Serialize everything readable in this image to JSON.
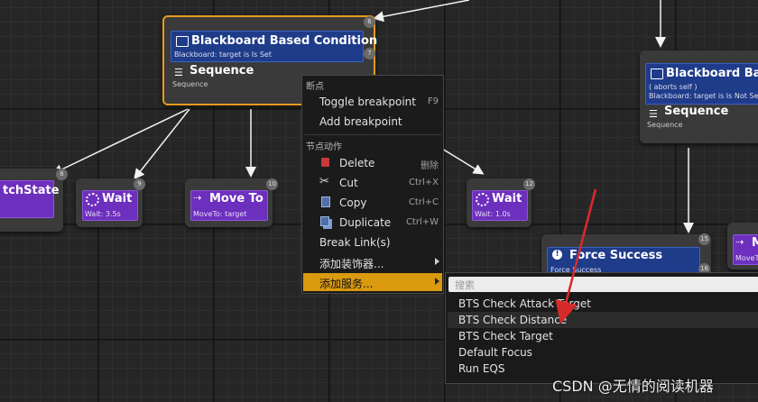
{
  "nodes": {
    "root_sequence": {
      "badge_top": "6",
      "decorator_title": "Blackboard Based Condition",
      "decorator_sub": "Blackboard: target is Is Set",
      "badge_decorator": "7",
      "title": "Sequence",
      "sub": "Sequence"
    },
    "left_task": {
      "title": "tchState",
      "badge": "8"
    },
    "wait_1": {
      "title": "Wait",
      "sub": "Wait: 3.5s",
      "badge": "9"
    },
    "move_to": {
      "title": "Move To",
      "sub": "MoveTo: target",
      "badge": "10"
    },
    "wait_2": {
      "title": "Wait",
      "sub": "Wait: 1.0s",
      "badge": "12"
    },
    "right_sequence": {
      "decorator_title": "Blackboard Bas",
      "decorator_sub1": "( aborts self )",
      "decorator_sub2": "Blackboard: target is Is Not Se",
      "title": "Sequence",
      "sub": "Sequence"
    },
    "force_success": {
      "title": "Force Success",
      "sub": "Force Success",
      "badge": "15",
      "badge2": "16"
    },
    "move_right": {
      "title": "M",
      "sub": "MoveT"
    }
  },
  "context_menu": {
    "section1": "断点",
    "toggle_breakpoint": "Toggle breakpoint",
    "toggle_breakpoint_shortcut": "F9",
    "add_breakpoint": "Add breakpoint",
    "section2": "节点动作",
    "delete": "Delete",
    "delete_shortcut": "删除",
    "cut": "Cut",
    "cut_shortcut": "Ctrl+X",
    "copy": "Copy",
    "copy_shortcut": "Ctrl+C",
    "duplicate": "Duplicate",
    "duplicate_shortcut": "Ctrl+W",
    "break_links": "Break Link(s)",
    "add_decorator": "添加装饰器...",
    "add_service": "添加服务..."
  },
  "submenu": {
    "search_placeholder": "搜索",
    "items": [
      "BTS Check Attack Target",
      "BTS Check Distance",
      "BTS Check Target",
      "Default Focus",
      "Run EQS"
    ]
  },
  "watermark": "CSDN @无情的阅读机器",
  "colors": {
    "selection": "#e59a1c",
    "decorator": "#1f3c8a",
    "task": "#6d2fbd",
    "menu_highlight": "#d99a0f",
    "arrow": "#d62a2a"
  }
}
